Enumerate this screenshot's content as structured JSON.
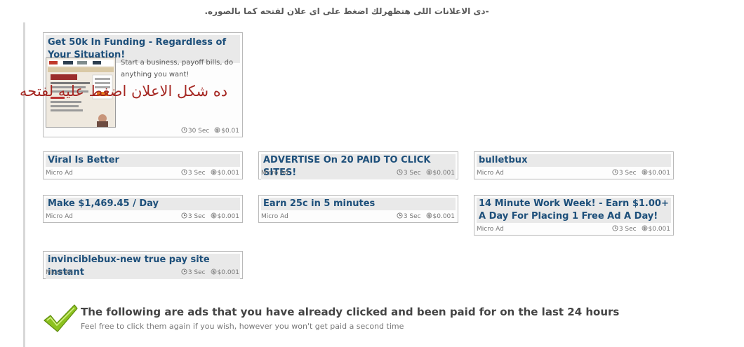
{
  "instruction_text": "-دى الاعلانات اللى هتظهرلك اضغط على اى علان لفتحه كما بالصوره.",
  "overlay_note": "ده شكل الاعلان اضغط عليه لفتحه",
  "featured_ad": {
    "title": "Get 50k In Funding - Regardless of Your Situation!",
    "description": "Start a business, payoff bills, do anything you want!",
    "duration": "30 Sec",
    "reward": "$0.01"
  },
  "ads": [
    {
      "title": "Viral Is Better",
      "label": "Micro Ad",
      "duration": "3 Sec",
      "reward": "$0.001"
    },
    {
      "title": "ADVERTISE On 20 PAID TO CLICK SITES!",
      "label": "Micro Ad",
      "duration": "3 Sec",
      "reward": "$0.001"
    },
    {
      "title": "bulletbux",
      "label": "Micro Ad",
      "duration": "3 Sec",
      "reward": "$0.001"
    },
    {
      "title": "Make $1,469.45 / Day",
      "label": "Micro Ad",
      "duration": "3 Sec",
      "reward": "$0.001"
    },
    {
      "title": "Earn 25c in 5 minutes",
      "label": "Micro Ad",
      "duration": "3 Sec",
      "reward": "$0.001"
    },
    {
      "title": "14 Minute Work Week! - Earn $1.00+ A Day For Placing 1 Free Ad A Day!",
      "label": "Micro Ad",
      "duration": "3 Sec",
      "reward": "$0.001"
    },
    {
      "title": "invinciblebux-new true pay site instant",
      "label": "Micro Ad",
      "duration": "3 Sec",
      "reward": "$0.001"
    }
  ],
  "paid_section": {
    "heading": "The following are ads that you have already clicked and been paid for on the last 24 hours",
    "subtext": "Feel free to click them again if you wish, however you won't get paid a second time"
  },
  "colors": {
    "title_text": "#1d4f7a",
    "title_bg": "#e9e9e9",
    "overlay_red": "#a52722",
    "check_green": "#8cc21f"
  },
  "icons": {
    "duration": "clock-icon",
    "reward": "coin-icon",
    "paid": "checkmark-icon"
  }
}
